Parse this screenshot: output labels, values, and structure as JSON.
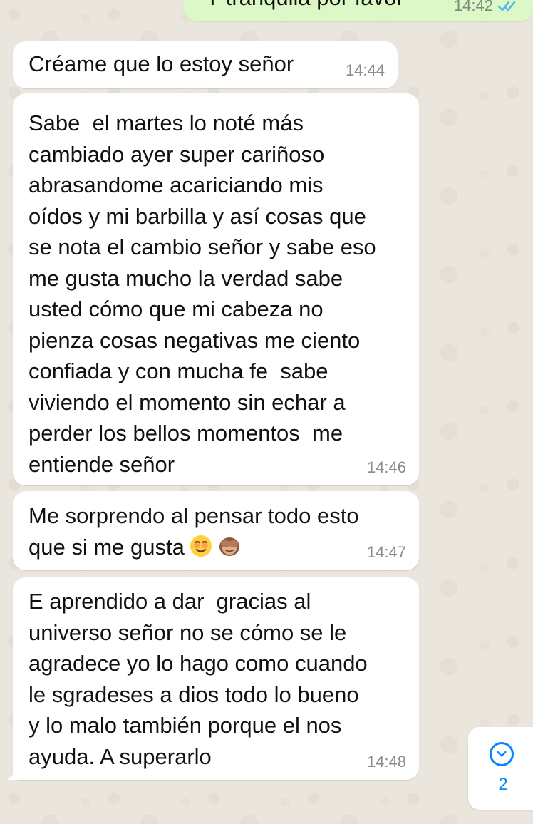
{
  "chat": {
    "outgoing": {
      "text": "Y tranquila por favor",
      "time": "14:42"
    },
    "messages": [
      {
        "text": "Créame que lo estoy señor",
        "time": "14:44"
      },
      {
        "text": "Sabe  el martes lo noté más\ncambiado ayer super cariñoso\nabrasandome acariciando mis\noídos y mi barbilla y así cosas que\nse nota el cambio señor y sabe eso\nme gusta mucho la verdad sabe\nusted cómo que mi cabeza no\npienza cosas negativas me ciento\nconfiada y con mucha fe  sabe\nviviendo el momento sin echar a\nperder los bellos momentos  me\nentiende señor",
        "time": "14:46"
      },
      {
        "text": "Me sorprendo al pensar todo esto\nque si me gusta",
        "time": "14:47",
        "emojis": [
          "smiling-face-emoji",
          "see-no-evil-monkey-emoji"
        ]
      },
      {
        "text": "E aprendido a dar  gracias al\nuniverso señor no se cómo se le\nagradece yo lo hago como cuando\nle sgradeses a dios todo lo bueno\ny lo malo también porque el nos\nayuda. A superarlo",
        "time": "14:48"
      }
    ]
  },
  "scroll_button": {
    "icon": "chevron-down-icon",
    "count": "2"
  },
  "colors": {
    "incoming_bubble": "#ffffff",
    "outgoing_bubble": "#dcf8c6",
    "accent": "#0b84ff",
    "background": "#ebe6dd"
  }
}
